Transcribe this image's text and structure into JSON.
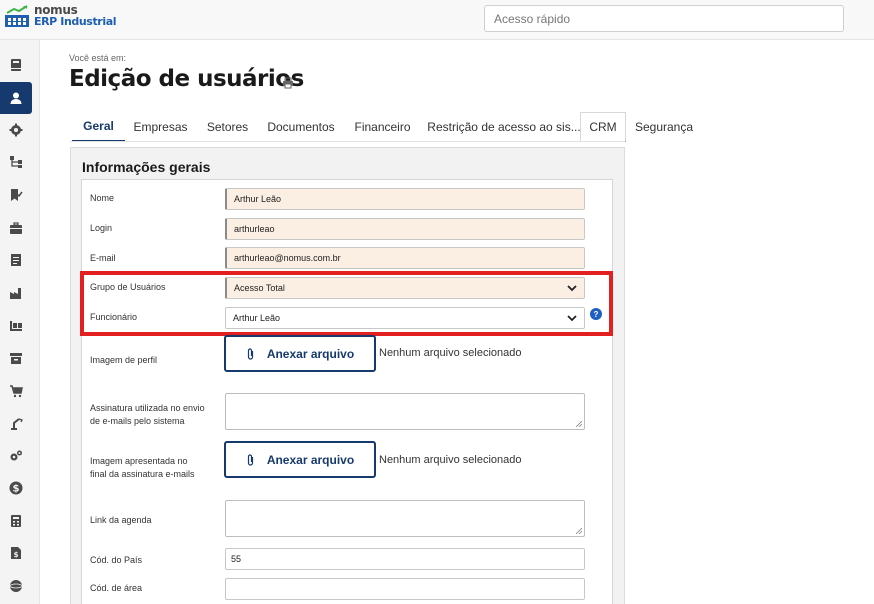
{
  "app": {
    "brand_name": "nomus",
    "brand_sub": "ERP Industrial"
  },
  "header": {
    "quick_access_placeholder": "Acesso rápido"
  },
  "sidebar": {
    "items": [
      {
        "icon": "book-icon"
      },
      {
        "icon": "user-icon",
        "active": true
      },
      {
        "icon": "gear-icon"
      },
      {
        "icon": "hierarchy-icon"
      },
      {
        "icon": "checklist-icon"
      },
      {
        "icon": "briefcase-icon"
      },
      {
        "icon": "receipt-icon"
      },
      {
        "icon": "factory-icon"
      },
      {
        "icon": "pallet-icon"
      },
      {
        "icon": "archive-box-icon"
      },
      {
        "icon": "cart-icon"
      },
      {
        "icon": "robot-arm-icon"
      },
      {
        "icon": "gears-icon"
      },
      {
        "icon": "dollar-icon"
      },
      {
        "icon": "calculator-icon"
      },
      {
        "icon": "invoice-icon"
      },
      {
        "icon": "globe-icon"
      }
    ]
  },
  "page": {
    "breadcrumb_label": "Você está em:",
    "title": "Edição de usuários"
  },
  "tabs": [
    {
      "label": "Geral",
      "active": true
    },
    {
      "label": "Empresas"
    },
    {
      "label": "Setores"
    },
    {
      "label": "Documentos"
    },
    {
      "label": "Financeiro"
    },
    {
      "label": "Restrição de acesso ao sis..."
    },
    {
      "label": "CRM"
    },
    {
      "label": "Segurança"
    }
  ],
  "form": {
    "section_title": "Informações gerais",
    "nome": {
      "label": "Nome",
      "value": "Arthur Leão"
    },
    "login": {
      "label": "Login",
      "value": "arthurleao"
    },
    "email": {
      "label": "E-mail",
      "value": "arthurleao@nomus.com.br"
    },
    "grupo": {
      "label": "Grupo de Usuários",
      "value": "Acesso Total"
    },
    "funcionario": {
      "label": "Funcionário",
      "value": "Arthur Leão",
      "help": "?"
    },
    "imagem_perfil": {
      "label": "Imagem de perfil",
      "button": "Anexar arquivo",
      "status": "Nenhum arquivo selecionado"
    },
    "assinatura": {
      "label_line1": "Assinatura utilizada no envio",
      "label_line2": "de e-mails pelo sistema"
    },
    "imagem_assinatura": {
      "label_line1": "Imagem apresentada no",
      "label_line2": "final da assinatura e-mails",
      "button": "Anexar arquivo",
      "status": "Nenhum arquivo selecionado"
    },
    "link_agenda": {
      "label": "Link da agenda"
    },
    "cod_pais": {
      "label": "Cód. do País",
      "value": "55"
    },
    "cod_area": {
      "label": "Cód. de área",
      "value": ""
    }
  },
  "colors": {
    "brand_dark": "#173a6e",
    "brand_blue": "#1e5fb0",
    "highlight_red": "#e32020",
    "required_bg": "#fbeee2"
  }
}
